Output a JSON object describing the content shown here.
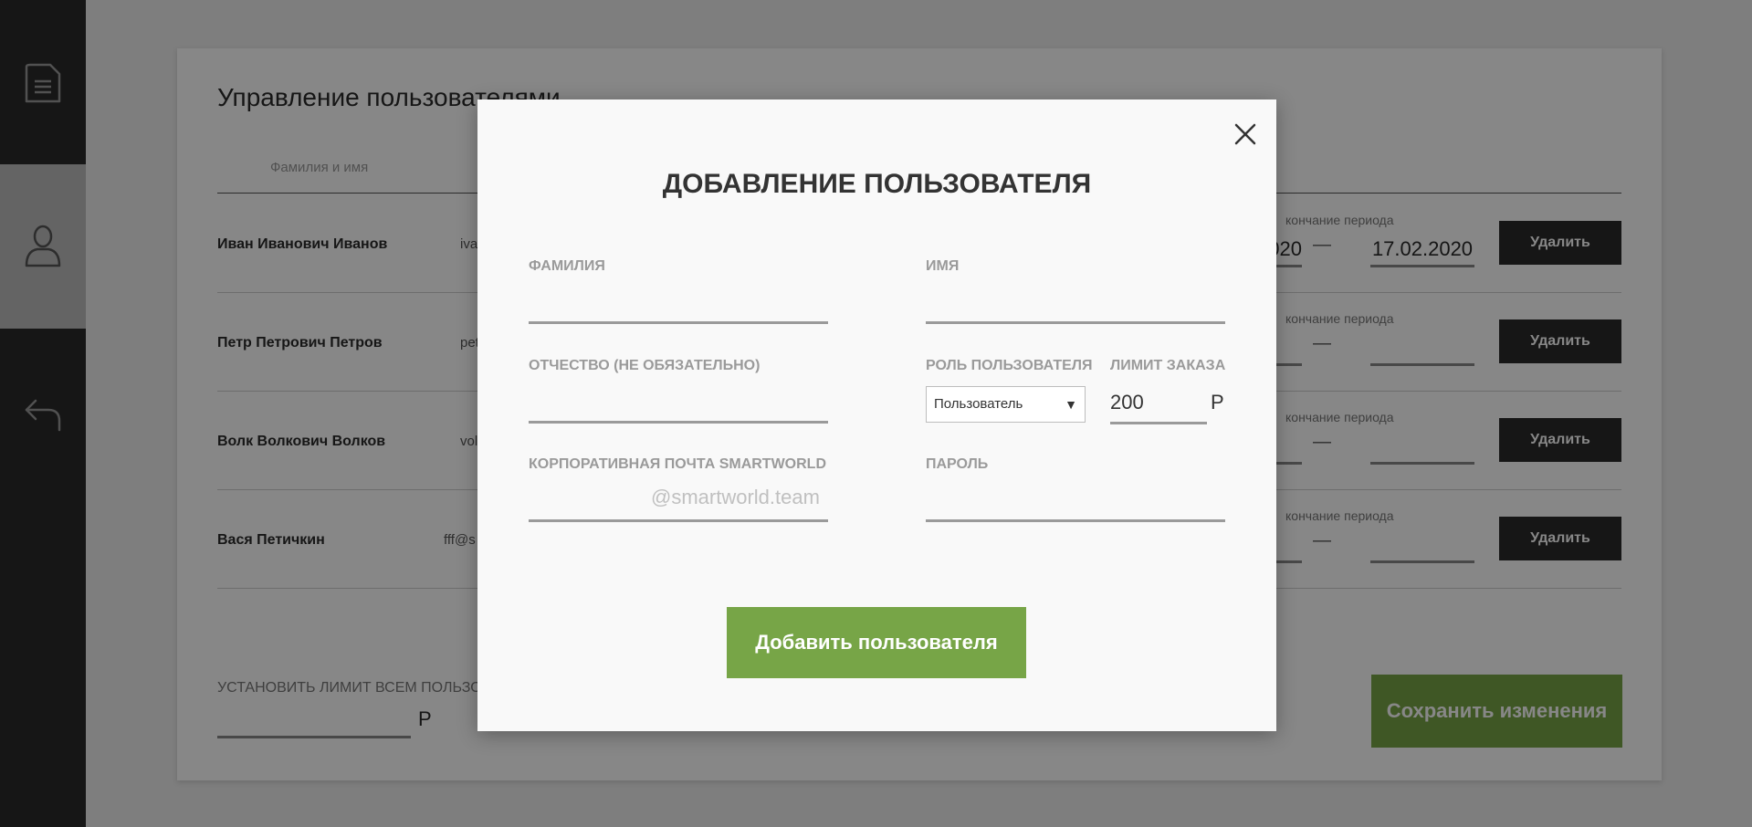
{
  "sidebar": {
    "items": [
      {
        "icon": "document-icon",
        "active": false
      },
      {
        "icon": "user-icon",
        "active": true
      },
      {
        "icon": "undo-icon",
        "active": false
      }
    ]
  },
  "main": {
    "title": "Управление пользователями",
    "column_header_name": "Фамилия и имя",
    "period_end_label": "Окончание периода",
    "rows": [
      {
        "name": "Иван Иванович Иванов",
        "email": "iva",
        "period_label": "кончание периода",
        "date_start": "020",
        "date_end": "17.02.2020",
        "delete_label": "Удалить"
      },
      {
        "name": "Петр Петрович Петров",
        "email": "pet",
        "period_label": "кончание периода",
        "date_start": "",
        "date_end": "",
        "delete_label": "Удалить"
      },
      {
        "name": "Волк Волкович Волков",
        "email": "vol",
        "period_label": "кончание периода",
        "date_start": "",
        "date_end": "",
        "delete_label": "Удалить"
      },
      {
        "name": "Вася Петичкин",
        "email": "fff@s",
        "period_label": "кончание периода",
        "date_start": "",
        "date_end": "",
        "delete_label": "Удалить"
      }
    ],
    "date_dash": "—",
    "bottom_limit_label": "УСТАНОВИТЬ ЛИМИТ ВСЕМ ПОЛЬЗО",
    "bottom_currency": "Р",
    "save_label": "Сохранить изменения"
  },
  "modal": {
    "title": "ДОБАВЛЕНИЕ ПОЛЬЗОВАТЕЛЯ",
    "fields": {
      "last_name_label": "ФАМИЛИЯ",
      "first_name_label": "ИМЯ",
      "middle_name_label": "ОТЧЕСТВО (НЕ ОБЯЗАТЕЛЬНО)",
      "role_label": "РОЛЬ ПОЛЬЗОВАТЕЛЯ",
      "role_value": "Пользователь",
      "limit_label": "ЛИМИТ ЗАКАЗА",
      "limit_value": "200",
      "limit_currency": "Р",
      "email_label": "КОРПОРАТИВНАЯ ПОЧТА SMARTWORLD",
      "email_suffix": "@smartworld.team",
      "password_label": "ПАРОЛЬ"
    },
    "add_button_label": "Добавить пользователя"
  },
  "colors": {
    "sidebar_bg": "#2a2a2a",
    "accent_green": "#77a547",
    "delete_button_bg": "#2a2a2a"
  }
}
